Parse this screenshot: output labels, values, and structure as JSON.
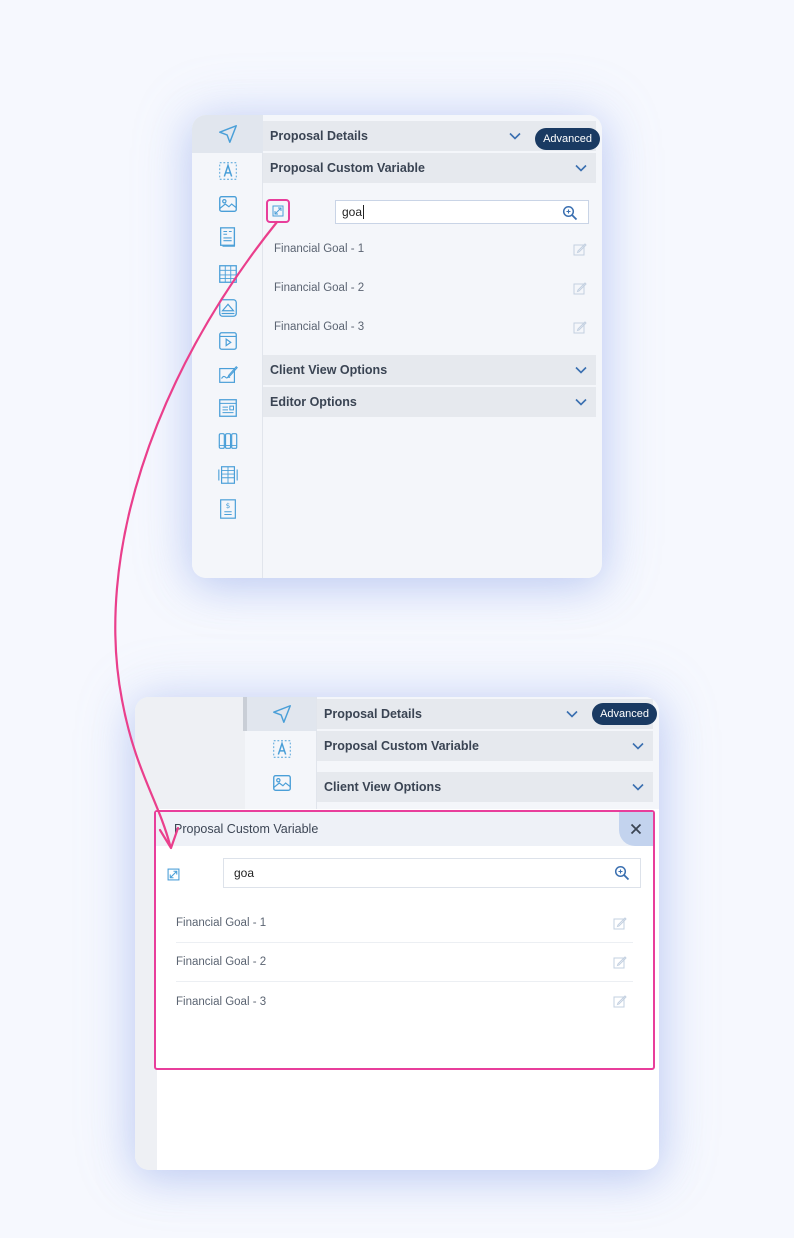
{
  "colors": {
    "accent_pink": "#e83e9b",
    "navy_badge": "#1a3a62",
    "icon_blue": "#4a9fd8",
    "header_gray": "#e6e9ee"
  },
  "editor": {
    "toolbar_icons": [
      "pointer-icon",
      "text-icon",
      "image-icon",
      "document-icon",
      "table-icon",
      "cover-image-icon",
      "video-icon",
      "signature-icon",
      "layout-icon",
      "columns-icon",
      "grid-list-icon",
      "pricing-icon"
    ],
    "sections": {
      "proposal_details": "Proposal Details",
      "proposal_custom_variable": "Proposal Custom Variable",
      "client_view_options": "Client View Options",
      "editor_options": "Editor Options"
    },
    "advanced_badge": "Advanced",
    "search_value": "goa",
    "variables": [
      "Financial Goal - 1",
      "Financial Goal - 2",
      "Financial Goal - 3"
    ]
  },
  "expanded": {
    "sections": {
      "proposal_details": "Proposal Details",
      "proposal_custom_variable": "Proposal Custom Variable",
      "client_view_options": "Client View Options"
    },
    "advanced_badge": "Advanced",
    "modal": {
      "title": "Proposal Custom Variable",
      "search_value": "goa",
      "variables": [
        "Financial Goal - 1",
        "Financial Goal - 2",
        "Financial Goal - 3"
      ]
    }
  }
}
